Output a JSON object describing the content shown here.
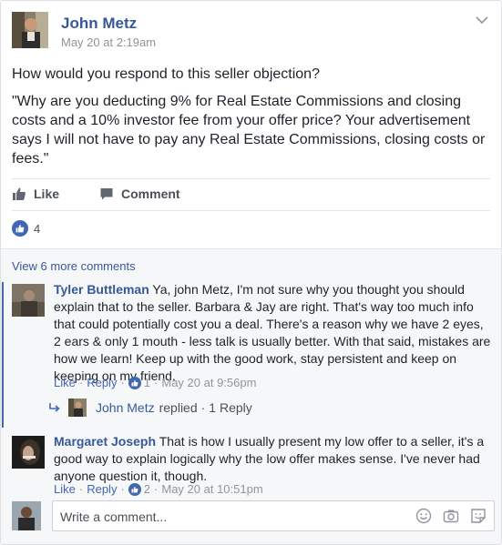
{
  "post": {
    "author": "John Metz",
    "time": "May 20 at 2:19am",
    "text_line1": "How would you respond to this seller objection?",
    "text_quote": "\"Why are you deducting 9% for Real Estate Commissions and closing costs and a 10% investor fee from your offer price? Your advertisement says I will not have to pay any Real Estate Commissions, closing costs or fees.\""
  },
  "actions": {
    "like_label": "Like",
    "comment_label": "Comment"
  },
  "reactions": {
    "count": "4"
  },
  "comments": {
    "view_more": "View 6 more comments",
    "items": [
      {
        "author": "Tyler Buttleman",
        "text": "Ya, john Metz, I'm not sure why you thought you should explain that to the seller. Barbara & Jay are right. That's way too much info that could potentially cost you a deal. There's a reason why we have 2 eyes, 2 ears & only 1 mouth - less talk is usually better. With that said, mistakes are how we learn! Keep up with the good work, stay persistent and keep on keeping on my friend.",
        "like_label": "Like",
        "reply_label": "Reply",
        "like_count": "1",
        "time": "May 20 at 9:56pm",
        "replies_summary": {
          "author": "John Metz",
          "replied_label": "replied",
          "count_label": "1 Reply"
        }
      },
      {
        "author": "Margaret Joseph",
        "text": "That is how I usually present my low offer to a seller, it's a good way to explain logically why the low offer makes sense. I've never had anyone question it, though.",
        "like_label": "Like",
        "reply_label": "Reply",
        "like_count": "2",
        "time": "May 20 at 10:51pm"
      }
    ]
  },
  "composer": {
    "placeholder": "Write a comment..."
  },
  "colors": {
    "link_blue": "#365899",
    "brand_blue": "#4267b2",
    "meta_gray": "#90949c",
    "comments_bg": "#f6f7f9"
  },
  "icons": [
    "chevron-down-icon",
    "like-thumb-icon",
    "comment-bubble-icon",
    "reply-arrow-icon",
    "emoji-icon",
    "camera-icon",
    "sticker-icon"
  ]
}
